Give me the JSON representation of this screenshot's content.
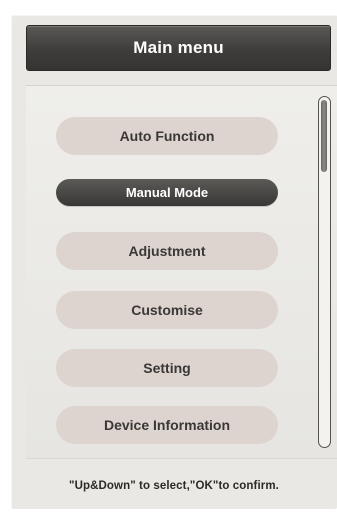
{
  "header": {
    "title": "Main menu"
  },
  "menu": {
    "items": [
      {
        "label": "Auto Function",
        "selected": false
      },
      {
        "label": "Manual Mode",
        "selected": true
      },
      {
        "label": "Adjustment",
        "selected": false
      },
      {
        "label": "Customise",
        "selected": false
      },
      {
        "label": "Setting",
        "selected": false
      },
      {
        "label": "Device Information",
        "selected": false
      }
    ]
  },
  "footer": {
    "hint": "\"Up&Down\" to select,\"OK\"to confirm."
  },
  "colors": {
    "title_bar": "#403e3b",
    "selected_item": "#454341",
    "unselected_item": "#ddd3cf",
    "screen_background": "#e9e8e4"
  }
}
